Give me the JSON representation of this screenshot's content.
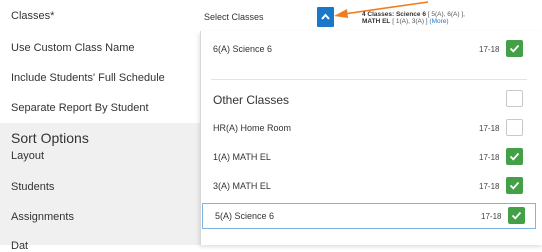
{
  "left_panel": {
    "classes_label": "Classes*",
    "use_custom_class_name": "Use Custom Class Name",
    "include_full_schedule": "Include Students' Full Schedule",
    "separate_by_student": "Separate Report By Student",
    "sort_options": "Sort Options",
    "layout": "Layout",
    "students": "Students",
    "assignments": "Assignments",
    "partial_bottom": "Dat"
  },
  "class_select": {
    "value": "Select Classes",
    "summary_bold": "4 Classes: Science 6",
    "summary_mid": " [ 5(A), 6(A) ],",
    "summary_line2_bold": "MATH EL",
    "summary_line2": " [ 1(A), 3(A) ] ",
    "summary_more": "(More)"
  },
  "dropdown": {
    "selected_items": [
      {
        "name": "6(A) Science 6",
        "year": "17-18",
        "checked": true
      }
    ],
    "other_classes_title": "Other Classes",
    "other_items": [
      {
        "name": "HR(A) Home Room",
        "year": "17-18",
        "checked": false
      },
      {
        "name": "1(A) MATH EL",
        "year": "17-18",
        "checked": true
      },
      {
        "name": "3(A) MATH EL",
        "year": "17-18",
        "checked": true
      },
      {
        "name": "5(A) Science 6",
        "year": "17-18",
        "checked": true
      }
    ]
  },
  "colors": {
    "accent": "#1b78c8",
    "check_green": "#43a047",
    "annotation_arrow": "#f07c1e"
  },
  "icons": {
    "toggle": "chevron-up-icon",
    "check": "check-icon",
    "annotation": "arrow-pointer-icon"
  }
}
